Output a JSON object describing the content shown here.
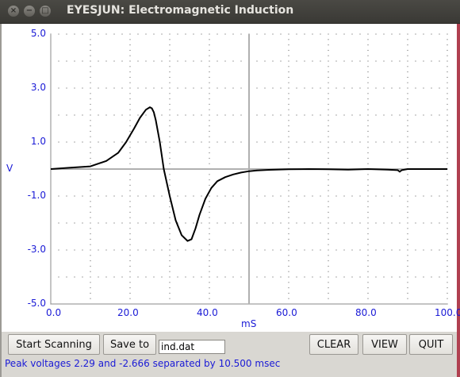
{
  "window": {
    "title": "EYESJUN: Electromagnetic Induction",
    "close_glyph": "×",
    "minimize_glyph": "−",
    "maximize_glyph": "□"
  },
  "colors": {
    "axis_text": "#1a1ad6",
    "trace": "#000000",
    "grid_dots": "#555555",
    "crosshair": "#b0b0b0",
    "background": "#ffffff"
  },
  "controls": {
    "start_label": "Start Scanning",
    "save_label": "Save to",
    "filename": "ind.dat",
    "clear_label": "CLEAR",
    "view_label": "VIEW",
    "quit_label": "QUIT"
  },
  "status": {
    "text": "Peak voltages  2.29 and -2.666 separated by 10.500 msec"
  },
  "chart_data": {
    "type": "line",
    "xlabel": "mS",
    "ylabel": "V",
    "xlim": [
      0,
      100
    ],
    "ylim": [
      -5,
      5
    ],
    "x_ticks": [
      "0.0",
      "20.0",
      "40.0",
      "60.0",
      "80.0",
      "100.0"
    ],
    "y_ticks": [
      "5.0",
      "3.0",
      "1.0",
      "-1.0",
      "-3.0",
      "-5.0"
    ],
    "grid": "dotted",
    "crosshair": [
      50,
      0
    ],
    "series": [
      {
        "x": [
          0,
          5,
          10,
          14,
          17,
          19,
          21,
          22.5,
          24,
          25,
          25.5,
          26,
          26.5,
          27.5,
          28.5,
          30,
          31.5,
          33,
          34.5,
          35.5,
          36.5,
          37.5,
          39,
          40.5,
          42,
          44,
          46,
          48,
          50,
          52,
          55,
          60,
          65,
          70,
          75,
          80,
          85,
          87.5,
          88,
          88.5,
          90,
          95,
          100
        ],
        "y": [
          0,
          0.05,
          0.1,
          0.3,
          0.6,
          1.0,
          1.5,
          1.9,
          2.2,
          2.29,
          2.25,
          2.1,
          1.8,
          1.0,
          0.0,
          -1.0,
          -1.9,
          -2.45,
          -2.666,
          -2.6,
          -2.2,
          -1.7,
          -1.1,
          -0.7,
          -0.45,
          -0.3,
          -0.2,
          -0.13,
          -0.08,
          -0.05,
          -0.03,
          -0.01,
          0.0,
          -0.01,
          -0.02,
          0.0,
          -0.02,
          -0.04,
          -0.1,
          -0.04,
          0.0,
          0.0,
          0.0
        ]
      }
    ]
  }
}
